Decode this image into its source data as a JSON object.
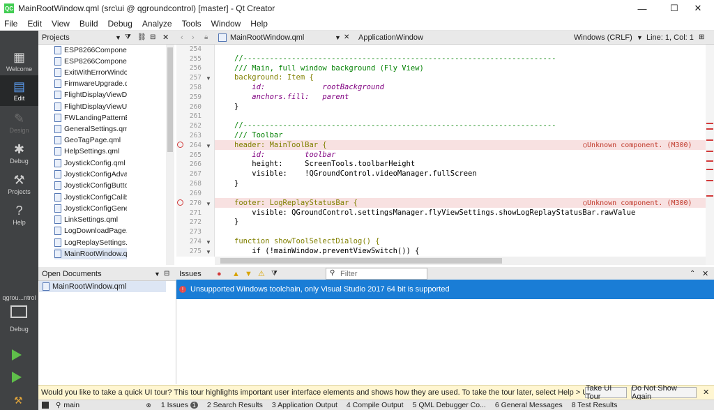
{
  "titlebar": {
    "icon": "QC",
    "title": "MainRootWindow.qml (src\\ui @ qgroundcontrol) [master] - Qt Creator",
    "minimize": "—",
    "maximize": "☐",
    "close": "✕"
  },
  "menu": [
    "File",
    "Edit",
    "View",
    "Build",
    "Debug",
    "Analyze",
    "Tools",
    "Window",
    "Help"
  ],
  "modes": [
    {
      "label": "Welcome",
      "icon": "grid-icon"
    },
    {
      "label": "Edit",
      "icon": "document-icon"
    },
    {
      "label": "Design",
      "icon": "pencil-icon"
    },
    {
      "label": "Debug",
      "icon": "bug-icon"
    },
    {
      "label": "Projects",
      "icon": "wrench-icon"
    },
    {
      "label": "Help",
      "icon": "question-icon"
    }
  ],
  "kit": {
    "name": "qgrou...ntrol",
    "label": "Debug"
  },
  "projects": {
    "title": "Projects",
    "files": [
      "ESP8266Component",
      "ESP8266Component",
      "ExitWithErrorWindov",
      "FirmwareUpgrade.qr",
      "FlightDisplayViewDu",
      "FlightDisplayViewUV",
      "FWLandingPatternEc",
      "GeneralSettings.qml",
      "GeoTagPage.qml",
      "HelpSettings.qml",
      "JoystickConfig.qml",
      "JoystickConfigAdvar",
      "JoystickConfigButto",
      "JoystickConfigCalibr",
      "JoystickConfigGener",
      "LinkSettings.qml",
      "LogDownloadPage.c",
      "LogReplaySettings.q",
      "MainRootWindow.qı"
    ]
  },
  "editor": {
    "file": "MainRootWindow.qml",
    "symbol": "ApplicationWindow",
    "line_endings": "Windows (CRLF)",
    "position": "Line: 1, Col: 1",
    "error_text": "Unknown component. (M300)"
  },
  "code_lines": [
    {
      "n": "254",
      "t": ""
    },
    {
      "n": "255",
      "t": "//-----------------------------------------------------------------------"
    },
    {
      "n": "256",
      "t": "/// Main, full window background (Fly View)"
    },
    {
      "n": "257",
      "t": "background: Item {"
    },
    {
      "n": "258",
      "t": "    id:             rootBackground"
    },
    {
      "n": "259",
      "t": "    anchors.fill:   parent"
    },
    {
      "n": "260",
      "t": "}"
    },
    {
      "n": "261",
      "t": ""
    },
    {
      "n": "262",
      "t": "//-----------------------------------------------------------------------"
    },
    {
      "n": "263",
      "t": "/// Toolbar"
    },
    {
      "n": "264",
      "t": "header: MainToolBar {"
    },
    {
      "n": "265",
      "t": "    id:         toolbar"
    },
    {
      "n": "266",
      "t": "    height:     ScreenTools.toolbarHeight"
    },
    {
      "n": "267",
      "t": "    visible:    !QGroundControl.videoManager.fullScreen"
    },
    {
      "n": "268",
      "t": "}"
    },
    {
      "n": "269",
      "t": ""
    },
    {
      "n": "270",
      "t": "footer: LogReplayStatusBar {"
    },
    {
      "n": "271",
      "t": "    visible: QGroundControl.settingsManager.flyViewSettings.showLogReplayStatusBar.rawValue"
    },
    {
      "n": "272",
      "t": "}"
    },
    {
      "n": "273",
      "t": ""
    },
    {
      "n": "274",
      "t": "function showToolSelectDialog() {"
    },
    {
      "n": "275",
      "t": "    if (!mainWindow.preventViewSwitch()) {"
    }
  ],
  "open_documents": {
    "title": "Open Documents",
    "files": [
      "MainRootWindow.qml"
    ]
  },
  "issues": {
    "title": "Issues",
    "filter_placeholder": "Filter",
    "message": "Unsupported Windows toolchain, only Visual Studio 2017 64 bit is supported"
  },
  "tour": {
    "message": "Would you like to take a quick UI tour? This tour highlights important user interface elements and shows how they are used. To take the tour later, select Help > UI Tour.",
    "take": "Take UI Tour",
    "dismiss": "Do Not Show Again"
  },
  "statusbar": {
    "locator_value": "main",
    "tabs": [
      "1 Issues",
      "2 Search Results",
      "3 Application Output",
      "4 Compile Output",
      "5 QML Debugger Co...",
      "6 General Messages",
      "8 Test Results"
    ],
    "issue_count": "1"
  }
}
